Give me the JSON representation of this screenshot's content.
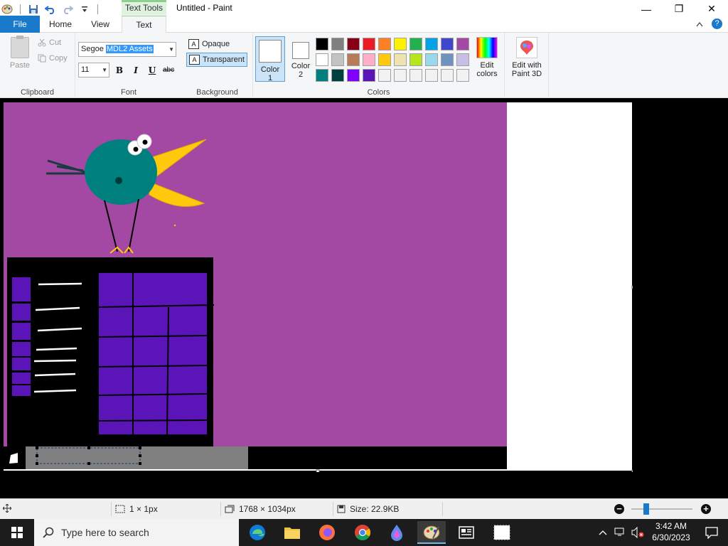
{
  "titlebar": {
    "contextual_tab": "Text Tools",
    "title": "Untitled - Paint",
    "minimize": "—",
    "restore": "❐",
    "close": "✕"
  },
  "tabs": {
    "file": "File",
    "home": "Home",
    "view": "View",
    "text": "Text",
    "help": "?"
  },
  "clipboard": {
    "paste": "Paste",
    "cut": "Cut",
    "copy": "Copy",
    "label": "Clipboard"
  },
  "font": {
    "name_prefix": "Segoe ",
    "name_selected": "MDL2 Assets",
    "size": "11",
    "bold": "B",
    "italic": "I",
    "underline": "U",
    "strike": "abc",
    "label": "Font"
  },
  "background": {
    "opaque": "Opaque",
    "transparent": "Transparent",
    "label": "Background"
  },
  "colors": {
    "color1_label": "Color",
    "color1_num": "1",
    "color2_label": "Color",
    "color2_num": "2",
    "label": "Colors",
    "edit_colors": "Edit",
    "edit_colors_2": "colors",
    "palette": [
      "#000000",
      "#7f7f7f",
      "#880015",
      "#ed1c24",
      "#ff7f27",
      "#fff200",
      "#22b14c",
      "#00a2e8",
      "#3f48cc",
      "#a349a4",
      "#ffffff",
      "#c3c3c3",
      "#b97a57",
      "#ffaec9",
      "#ffc90e",
      "#efe4b0",
      "#b5e61d",
      "#99d9ea",
      "#7092be",
      "#c8bfe7",
      "#007f7f",
      "#004040",
      "#7f00ff",
      "#5b14b7",
      "#f2f2f2",
      "#f2f2f2",
      "#f2f2f2",
      "#f2f2f2",
      "#f2f2f2",
      "#f2f2f2"
    ]
  },
  "paint3d": {
    "line1": "Edit with",
    "line2": "Paint 3D"
  },
  "status": {
    "selection_size": "1 × 1px",
    "image_size": "1768 × 1034px",
    "file_size": "Size: 22.9KB"
  },
  "taskbar": {
    "search_placeholder": "Type here to search",
    "time": "3:42 AM",
    "date": "6/30/2023"
  }
}
